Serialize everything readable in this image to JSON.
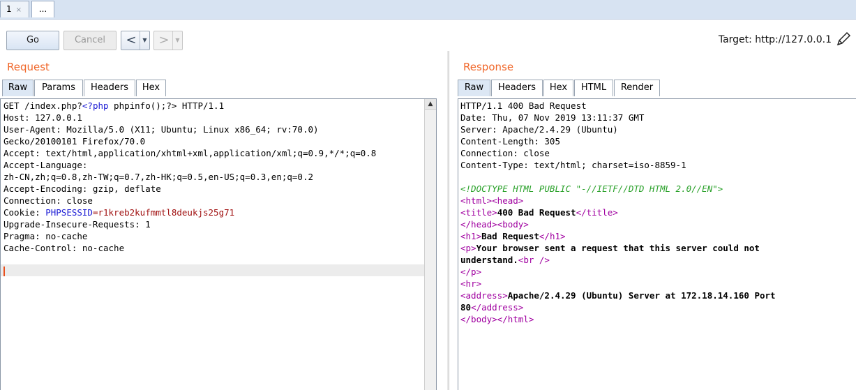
{
  "tabstrip": {
    "tab1_label": "1",
    "tab1_close": "×",
    "tab2_label": "..."
  },
  "toolbar": {
    "go_label": "Go",
    "cancel_label": "Cancel",
    "back_arrow": "<",
    "forward_arrow": ">",
    "dropdown_glyph": "▼",
    "target_text": "Target: http://127.0.0.1"
  },
  "request": {
    "title": "Request",
    "tabs": [
      "Raw",
      "Params",
      "Headers",
      "Hex"
    ],
    "selected_tab": "Raw",
    "lines": [
      [
        {
          "t": "GET /index.php?"
        },
        {
          "t": "<?php",
          "c": "blue"
        },
        {
          "t": " phpinfo();?> HTTP/1.1"
        }
      ],
      [
        {
          "t": "Host: 127.0.0.1"
        }
      ],
      [
        {
          "t": "User-Agent: Mozilla/5.0 (X11; Ubuntu; Linux x86_64; rv:70.0)"
        }
      ],
      [
        {
          "t": "Gecko/20100101 Firefox/70.0"
        }
      ],
      [
        {
          "t": "Accept: text/html,application/xhtml+xml,application/xml;q=0.9,*/*;q=0.8"
        }
      ],
      [
        {
          "t": "Accept-Language:"
        }
      ],
      [
        {
          "t": "zh-CN,zh;q=0.8,zh-TW;q=0.7,zh-HK;q=0.5,en-US;q=0.3,en;q=0.2"
        }
      ],
      [
        {
          "t": "Accept-Encoding: gzip, deflate"
        }
      ],
      [
        {
          "t": "Connection: close"
        }
      ],
      [
        {
          "t": "Cookie: "
        },
        {
          "t": "PHPSESSID",
          "c": "blue"
        },
        {
          "t": "=r1kreb2kufmmtl8deukjs25g71",
          "c": "red"
        }
      ],
      [
        {
          "t": "Upgrade-Insecure-Requests: 1"
        }
      ],
      [
        {
          "t": "Pragma: no-cache"
        }
      ],
      [
        {
          "t": "Cache-Control: no-cache"
        }
      ]
    ]
  },
  "response": {
    "title": "Response",
    "tabs": [
      "Raw",
      "Headers",
      "Hex",
      "HTML",
      "Render"
    ],
    "selected_tab": "Raw",
    "lines": [
      [
        {
          "t": "HTTP/1.1 400 Bad Request"
        }
      ],
      [
        {
          "t": "Date: Thu, 07 Nov 2019 13:11:37 GMT"
        }
      ],
      [
        {
          "t": "Server: Apache/2.4.29 (Ubuntu)"
        }
      ],
      [
        {
          "t": "Content-Length: 305"
        }
      ],
      [
        {
          "t": "Connection: close"
        }
      ],
      [
        {
          "t": "Content-Type: text/html; charset=iso-8859-1"
        }
      ],
      [
        {
          "t": ""
        }
      ],
      [
        {
          "t": "<!DOCTYPE HTML PUBLIC \"-//IETF//DTD HTML 2.0//EN\">",
          "c": "green"
        }
      ],
      [
        {
          "t": "<html><head>",
          "c": "purple"
        }
      ],
      [
        {
          "t": "<title>",
          "c": "purple"
        },
        {
          "t": "400 Bad Request",
          "b": true
        },
        {
          "t": "</title>",
          "c": "purple"
        }
      ],
      [
        {
          "t": "</head><body>",
          "c": "purple"
        }
      ],
      [
        {
          "t": "<h1>",
          "c": "purple"
        },
        {
          "t": "Bad Request",
          "b": true
        },
        {
          "t": "</h1>",
          "c": "purple"
        }
      ],
      [
        {
          "t": "<p>",
          "c": "purple"
        },
        {
          "t": "Your browser sent a request that this server could not",
          "b": true
        }
      ],
      [
        {
          "t": "understand.",
          "b": true
        },
        {
          "t": "<br />",
          "c": "purple"
        }
      ],
      [
        {
          "t": "</p>",
          "c": "purple"
        }
      ],
      [
        {
          "t": "<hr>",
          "c": "purple"
        }
      ],
      [
        {
          "t": "<address>",
          "c": "purple"
        },
        {
          "t": "Apache/2.4.29 (Ubuntu) Server at 172.18.14.160 Port",
          "b": true
        }
      ],
      [
        {
          "t": "80",
          "b": true
        },
        {
          "t": "</address>",
          "c": "purple"
        }
      ],
      [
        {
          "t": "</body></html>",
          "c": "purple"
        }
      ]
    ]
  },
  "colors": {
    "accent_title": "#f0672a",
    "selected_tab": "#dce7f4",
    "caret": "#e8501e"
  },
  "icons": {
    "edit": "pencil-icon",
    "scroll_up": "scroll-up-arrow-icon"
  }
}
